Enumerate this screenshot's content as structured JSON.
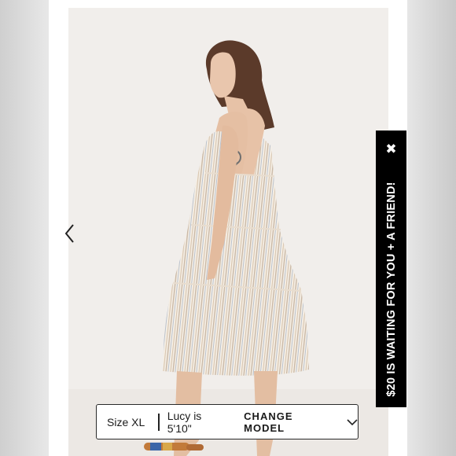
{
  "gallery": {
    "prev_icon": "chevron-left-icon"
  },
  "promo": {
    "text": "$20 IS WAITING FOR YOU + A FRIEND!",
    "close_glyph": "✖",
    "background": "#000000",
    "text_color": "#ffffff"
  },
  "size_bar": {
    "size": "Size XL",
    "model_info": "Lucy is 5'10\"",
    "change_label": "CHANGE MODEL",
    "chevron_icon": "chevron-down-icon"
  }
}
